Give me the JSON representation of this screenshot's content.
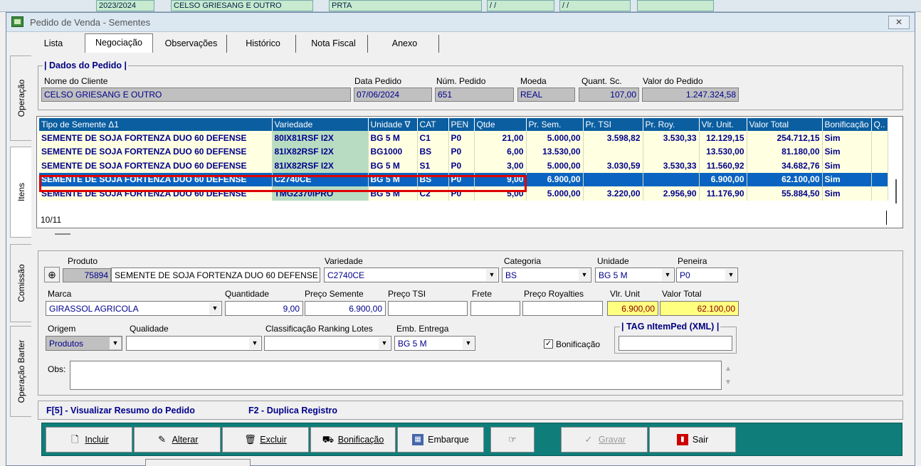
{
  "background": {
    "cells": [
      "2023/2024",
      "CELSO GRIESANG E OUTRO",
      "PRTA",
      "/ /",
      "/ /"
    ]
  },
  "window": {
    "title": "Pedido de Venda - Sementes",
    "close": "✕"
  },
  "tabs": [
    "Lista",
    "Negociação",
    "Observações",
    "Histórico",
    "Nota Fiscal",
    "Anexo"
  ],
  "vtabs": [
    "Operação",
    "Itens",
    "Comissão",
    "Operação Barter"
  ],
  "dados": {
    "legend": "| Dados do Pedido |",
    "nome_cliente_label": "Nome do Cliente",
    "nome_cliente": "CELSO GRIESANG E OUTRO",
    "data_label": "Data Pedido",
    "data": "07/06/2024",
    "num_label": "Núm. Pedido",
    "num": "651",
    "moeda_label": "Moeda",
    "moeda": "REAL",
    "quant_label": "Quant. Sc.",
    "quant": "107,00",
    "valor_label": "Valor do Pedido",
    "valor": "1.247.324,58"
  },
  "grid": {
    "columns": [
      "Tipo de Semente    Δ1",
      "Variedade",
      "Unidade ∇",
      "CAT",
      "PEN",
      "Qtde",
      "Pr. Sem.",
      "Pr. TSI",
      "Pr. Roy.",
      "Vlr. Unit.",
      "Valor Total",
      "Bonificação",
      "Q.."
    ],
    "rows": [
      [
        "SEMENTE DE SOJA FORTENZA DUO 60 DEFENSE",
        "80IX81RSF I2X",
        "BG 5 M",
        "C1",
        "P0",
        "21,00",
        "5.000,00",
        "3.598,82",
        "3.530,33",
        "12.129,15",
        "254.712,15",
        "Sim",
        ""
      ],
      [
        "SEMENTE DE SOJA FORTENZA DUO 60 DEFENSE",
        "81IX82RSF I2X",
        "BG1000",
        "BS",
        "P0",
        "6,00",
        "13.530,00",
        "",
        "",
        "13.530,00",
        "81.180,00",
        "Sim",
        ""
      ],
      [
        "SEMENTE DE SOJA FORTENZA DUO 60 DEFENSE",
        "81IX82RSF I2X",
        "BG 5 M",
        "S1",
        "P0",
        "3,00",
        "5.000,00",
        "3.030,59",
        "3.530,33",
        "11.560,92",
        "34.682,76",
        "Sim",
        ""
      ],
      [
        "SEMENTE DE SOJA FORTENZA DUO 60 DEFENSE",
        "C2740CE",
        "BG 5 M",
        "BS",
        "P0",
        "9,00",
        "6.900,00",
        "",
        "",
        "6.900,00",
        "62.100,00",
        "Sim",
        ""
      ],
      [
        "SEMENTE DE SOJA FORTENZA DUO 60 DEFENSE",
        "TMG2370IPRO",
        "BG 5 M",
        "C2",
        "P0",
        "5,00",
        "5.000,00",
        "3.220,00",
        "2.956,90",
        "11.176,90",
        "55.884,50",
        "Sim",
        ""
      ]
    ],
    "highlighted_row": 3,
    "counter": "10/11"
  },
  "item": {
    "produto_label": "Produto",
    "produto_cod": "75894",
    "produto_nome": "SEMENTE DE SOJA FORTENZA DUO 60 DEFENSE",
    "variedade_label": "Variedade",
    "variedade": "C2740CE",
    "categoria_label": "Categoria",
    "categoria": "BS",
    "unidade_label": "Unidade",
    "unidade": "BG 5 M",
    "peneira_label": "Peneira",
    "peneira": "P0",
    "marca_label": "Marca",
    "marca": "GIRASSOL AGRICOLA",
    "quantidade_label": "Quantidade",
    "quantidade": "9,00",
    "preco_semente_label": "Preço Semente",
    "preco_semente": "6.900,00",
    "preco_tsi_label": "Preço TSI",
    "preco_tsi": "",
    "frete_label": "Frete",
    "frete": "",
    "preco_royalties_label": "Preço Royalties",
    "preco_royalties": "",
    "vlr_unit_label": "Vlr. Unit",
    "vlr_unit": "6.900,00",
    "valor_total_label": "Valor Total",
    "valor_total": "62.100,00",
    "origem_label": "Origem",
    "origem": "Produtos",
    "qualidade_label": "Qualidade",
    "qualidade": "",
    "classificacao_label": "Classificação Ranking Lotes",
    "classificacao": "",
    "emb_label": "Emb. Entrega",
    "emb": "BG 5 M",
    "tag_legend": "| TAG nItemPed (XML) |",
    "tag": "",
    "bonificacao_label": "Bonificação",
    "bonificacao_checked": true,
    "obs_label": "Obs:",
    "obs": ""
  },
  "shortcuts": {
    "resumo": "F[5] - Visualizar Resumo do Pedido",
    "duplica": "F2 - Duplica Registro"
  },
  "buttons": {
    "incluir": "Incluir",
    "alterar": "Alterar",
    "excluir": "Excluir",
    "bonificacao": "Bonificação",
    "embarque": "Embarque",
    "gravar": "Gravar",
    "sair": "Sair"
  },
  "colors": {
    "header": "#0b5ea0",
    "highlight": "#0a63c0",
    "button_bar": "#0f7e7a",
    "label_blue": "#000080"
  }
}
